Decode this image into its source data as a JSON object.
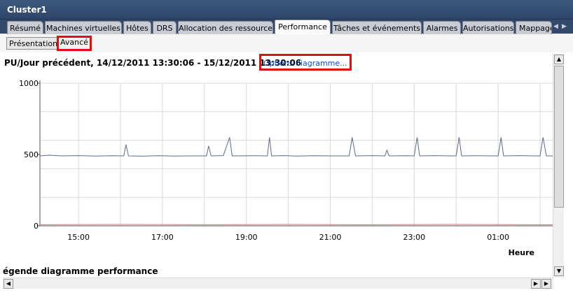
{
  "window": {
    "title": "Cluster1"
  },
  "tabs": [
    {
      "label": "Résumé"
    },
    {
      "label": "Machines virtuelles"
    },
    {
      "label": "Hôtes"
    },
    {
      "label": "DRS"
    },
    {
      "label": "Allocation des ressources"
    },
    {
      "label": "Performance",
      "active": true
    },
    {
      "label": "Tâches et événements"
    },
    {
      "label": "Alarmes"
    },
    {
      "label": "Autorisations"
    },
    {
      "label": "Mappage"
    }
  ],
  "view_buttons": {
    "overview": "Présentation",
    "advanced": "Avancé"
  },
  "chart_header": {
    "title": "PU/Jour précédent, 14/12/2011 13:30:06 - 15/12/2011 13:30:06",
    "options_link": "Options diagramme..."
  },
  "legend_title": "égende diagramme performance",
  "colors": {
    "series_main": "#5f6987",
    "series_low": "#d37a86",
    "highlight": "#e01010"
  },
  "chart_data": {
    "type": "line",
    "xlabel": "Heure",
    "ylabel": "",
    "ylim": [
      0,
      1000
    ],
    "yticks": [
      0,
      500,
      1000
    ],
    "xticks": [
      "15:00",
      "17:00",
      "19:00",
      "21:00",
      "23:00",
      "01:00"
    ],
    "xrange_hours": [
      14.08,
      26.3
    ],
    "grid": true,
    "series": [
      {
        "x": [
          14.08,
          14.3,
          14.6,
          15.0,
          15.4,
          15.8,
          16.08,
          16.13,
          16.19,
          16.5,
          16.9,
          17.3,
          17.7,
          18.05,
          18.1,
          18.16,
          18.45,
          18.6,
          18.66,
          18.75,
          19.2,
          19.5,
          19.55,
          19.6,
          19.9,
          20.2,
          20.6,
          21.0,
          21.45,
          21.52,
          21.6,
          22.0,
          22.3,
          22.35,
          22.4,
          22.8,
          23.0,
          23.07,
          23.13,
          23.5,
          23.9,
          24.0,
          24.07,
          24.13,
          24.5,
          24.9,
          25.0,
          25.07,
          25.13,
          25.5,
          25.9,
          26.0,
          26.07,
          26.15,
          26.3
        ],
        "values": [
          490,
          495,
          490,
          492,
          489,
          491,
          490,
          570,
          490,
          488,
          491,
          489,
          490,
          490,
          560,
          490,
          492,
          620,
          490,
          490,
          491,
          490,
          620,
          490,
          492,
          489,
          491,
          490,
          490,
          620,
          490,
          492,
          490,
          530,
          490,
          491,
          490,
          620,
          490,
          492,
          490,
          490,
          620,
          490,
          491,
          490,
          490,
          620,
          490,
          492,
          490,
          490,
          620,
          490,
          490
        ]
      },
      {
        "x": [
          14.08,
          16.0,
          18.0,
          20.0,
          22.0,
          24.0,
          26.3
        ],
        "values": [
          8,
          10,
          8,
          10,
          8,
          10,
          8
        ]
      }
    ]
  }
}
